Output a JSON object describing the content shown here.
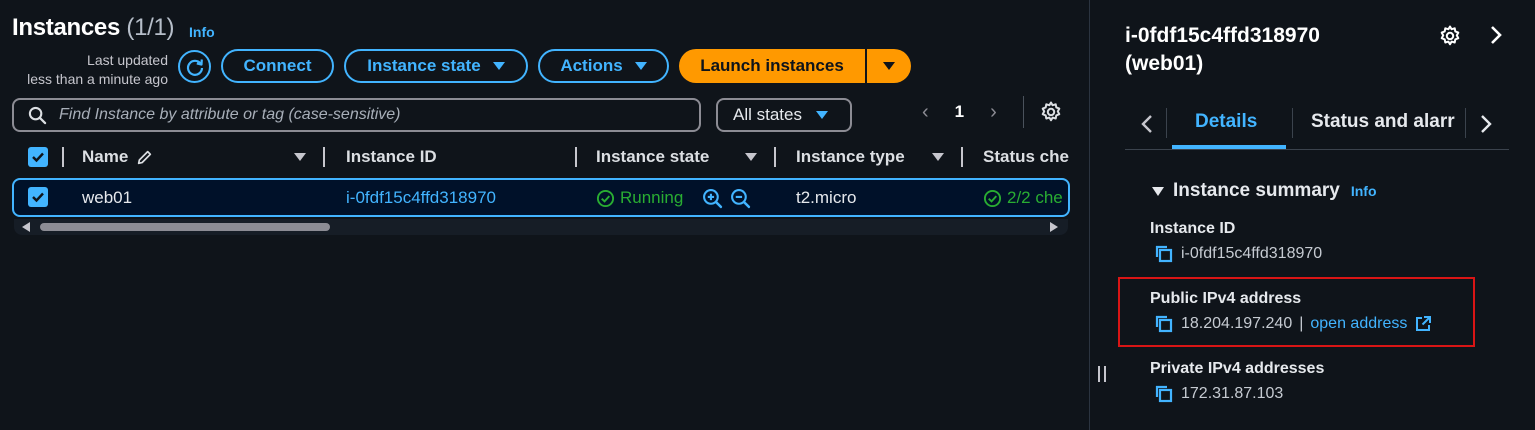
{
  "header": {
    "title": "Instances",
    "count": "(1/1)",
    "info": "Info",
    "last_updated_line1": "Last updated",
    "last_updated_line2": "less than a minute ago"
  },
  "toolbar": {
    "connect": "Connect",
    "instance_state": "Instance state",
    "actions": "Actions",
    "launch": "Launch instances"
  },
  "filter": {
    "search_placeholder": "Find Instance by attribute or tag (case-sensitive)",
    "states": "All states",
    "page": "1"
  },
  "table": {
    "columns": [
      "Name",
      "Instance ID",
      "Instance state",
      "Instance type",
      "Status che"
    ],
    "rows": [
      {
        "name": "web01",
        "instance_id": "i-0fdf15c4ffd318970",
        "state": "Running",
        "type": "t2.micro",
        "status": "2/2 che"
      }
    ]
  },
  "details": {
    "title_line1": "i-0fdf15c4ffd318970",
    "title_line2": "(web01)",
    "tabs": [
      "Details",
      "Status and alarr"
    ],
    "section": "Instance summary",
    "section_info": "Info",
    "instance_id_label": "Instance ID",
    "instance_id_value": "i-0fdf15c4ffd318970",
    "public_ip_label": "Public IPv4 address",
    "public_ip_value": "18.204.197.240",
    "public_ip_sep": "|",
    "open_address": "open address",
    "private_ip_label": "Private IPv4 addresses",
    "private_ip_value": "172.31.87.103"
  },
  "icons": {
    "refresh": "refresh-icon",
    "search": "search-icon",
    "gear": "gear-icon",
    "edit": "pencil-icon",
    "copy": "copy-icon",
    "external": "external-link-icon",
    "zoom_in": "zoom-in-icon",
    "zoom_out": "zoom-out-icon",
    "check_circle": "check-circle-icon"
  },
  "colors": {
    "background": "#0f141a",
    "accent": "#42b4ff",
    "launch": "#ff9900",
    "success": "#29ad32",
    "highlight": "#d91515"
  }
}
